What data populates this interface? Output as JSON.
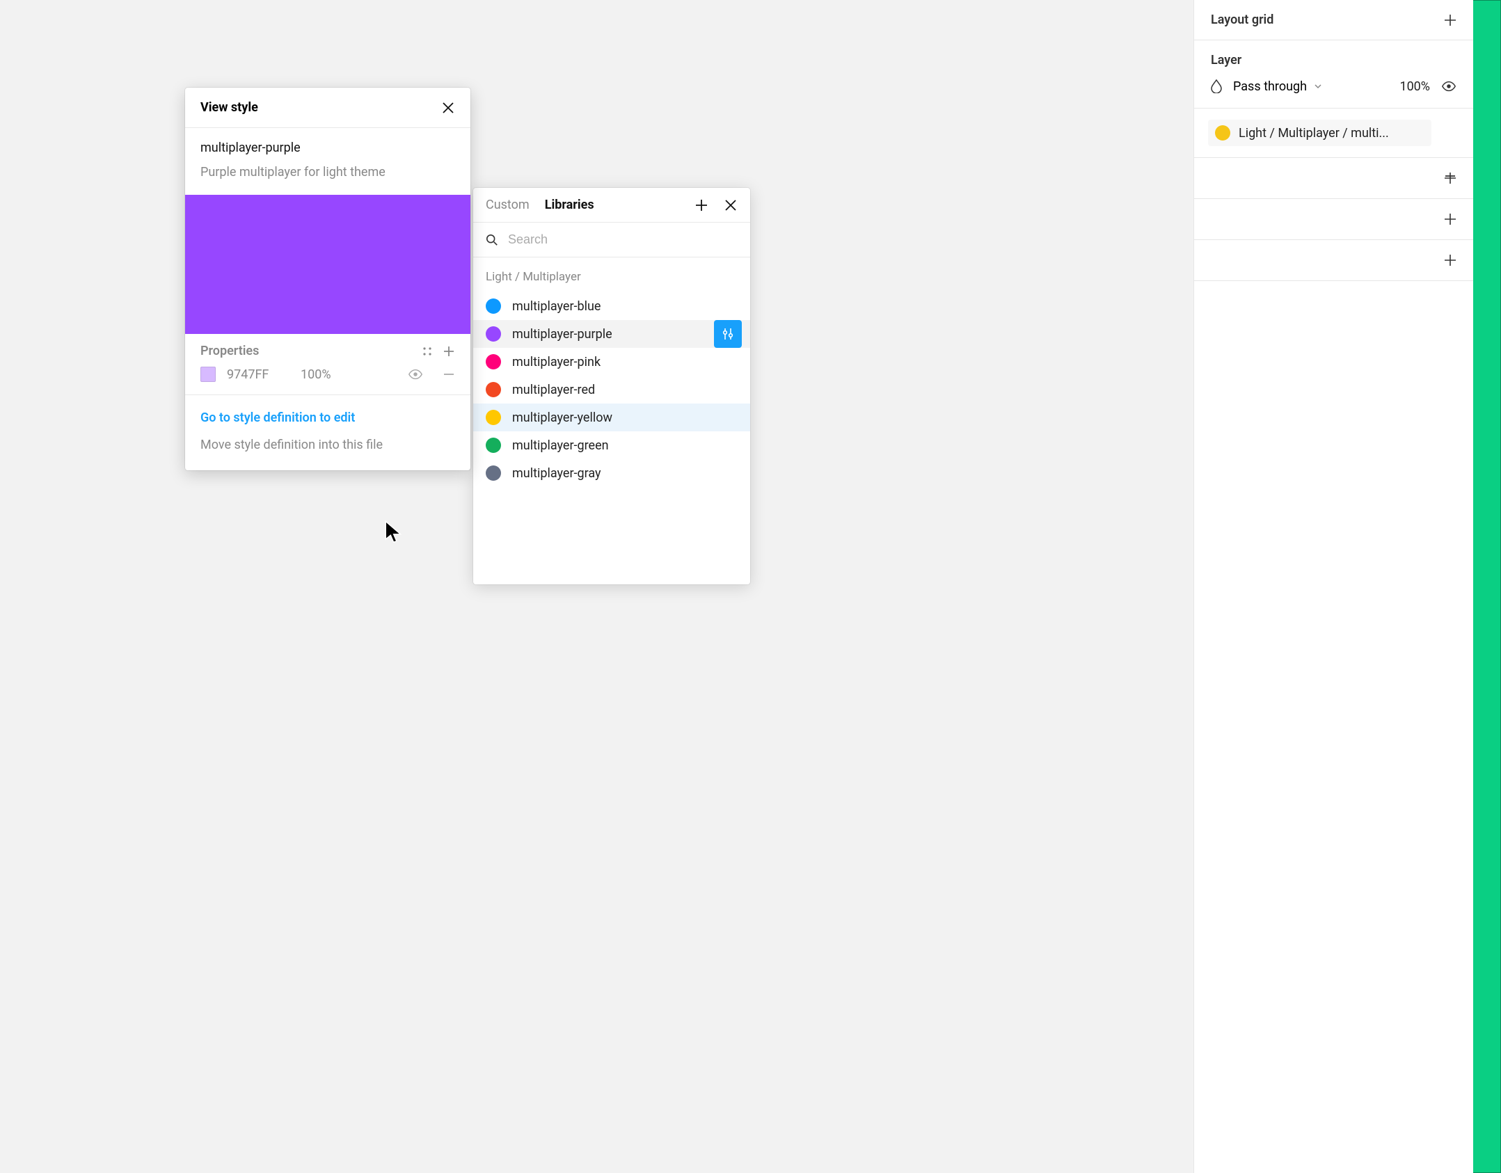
{
  "rightPanel": {
    "layoutGrid": {
      "label": "Layout grid"
    },
    "layer": {
      "label": "Layer",
      "blendMode": "Pass through",
      "opacity": "100%"
    },
    "appliedStyle": {
      "swatchColor": "#f5c518",
      "label": "Light / Multiplayer / multi..."
    }
  },
  "libraries": {
    "tabs": {
      "custom": "Custom",
      "libraries": "Libraries"
    },
    "searchPlaceholder": "Search",
    "groupLabel": "Light / Multiplayer",
    "items": [
      {
        "id": "blue",
        "label": "multiplayer-blue",
        "color": "#0d99ff"
      },
      {
        "id": "purple",
        "label": "multiplayer-purple",
        "color": "#9747ff",
        "selected": true
      },
      {
        "id": "pink",
        "label": "multiplayer-pink",
        "color": "#ff007a"
      },
      {
        "id": "red",
        "label": "multiplayer-red",
        "color": "#f24822"
      },
      {
        "id": "yellow",
        "label": "multiplayer-yellow",
        "color": "#ffc700",
        "highlight": true
      },
      {
        "id": "green",
        "label": "multiplayer-green",
        "color": "#14ae5c"
      },
      {
        "id": "gray",
        "label": "multiplayer-gray",
        "color": "#667085"
      }
    ]
  },
  "viewStyle": {
    "header": "View style",
    "name": "multiplayer-purple",
    "description": "Purple multiplayer for light theme",
    "previewColor": "#9747ff",
    "properties": {
      "label": "Properties",
      "swatchColor": "#d7baff",
      "hex": "9747FF",
      "opacity": "100%"
    },
    "actions": {
      "goTo": "Go to style definition to edit",
      "move": "Move style definition into this file"
    }
  }
}
